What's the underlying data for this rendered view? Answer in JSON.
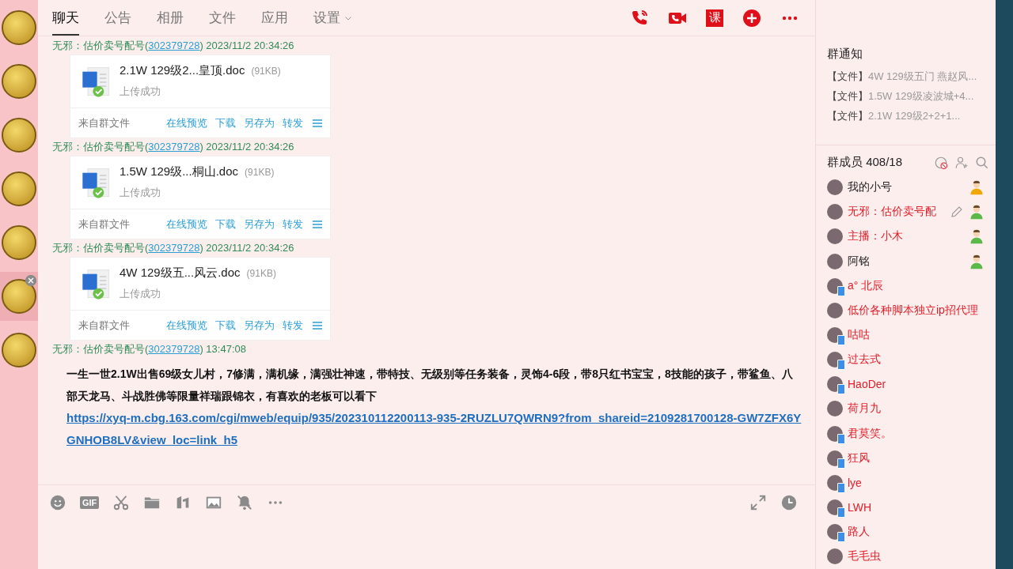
{
  "group_avatars": [
    {
      "selected": false
    },
    {
      "selected": false
    },
    {
      "selected": false
    },
    {
      "selected": false
    },
    {
      "selected": false
    },
    {
      "selected": true
    },
    {
      "selected": false
    }
  ],
  "tabs": [
    {
      "label": "聊天",
      "selected": true,
      "dropdown": false
    },
    {
      "label": "公告",
      "selected": false,
      "dropdown": false
    },
    {
      "label": "相册",
      "selected": false,
      "dropdown": false
    },
    {
      "label": "文件",
      "selected": false,
      "dropdown": false
    },
    {
      "label": "应用",
      "selected": false,
      "dropdown": false
    },
    {
      "label": "设置",
      "selected": false,
      "dropdown": true
    }
  ],
  "header_actions": [
    {
      "kind": "voice-call"
    },
    {
      "kind": "video-call"
    },
    {
      "kind": "course",
      "label": "课"
    },
    {
      "kind": "add"
    },
    {
      "kind": "more"
    }
  ],
  "messages": [
    {
      "kind": "file",
      "sender": "无邪：估价卖号配号(",
      "qq": "302379728",
      "time": ") 2023/11/2 20:34:26",
      "file": {
        "name": "2.1W  129级2...皇顶.doc",
        "size": "(91KB)",
        "status": "上传成功",
        "source": "来自群文件",
        "actions": [
          "在线预览",
          "下载",
          "另存为",
          "转发"
        ]
      }
    },
    {
      "kind": "file",
      "sender": "无邪：估价卖号配号(",
      "qq": "302379728",
      "time": ") 2023/11/2 20:34:26",
      "file": {
        "name": "1.5W  129级...桐山.doc",
        "size": "(91KB)",
        "status": "上传成功",
        "source": "来自群文件",
        "actions": [
          "在线预览",
          "下载",
          "另存为",
          "转发"
        ]
      }
    },
    {
      "kind": "file",
      "sender": "无邪：估价卖号配号(",
      "qq": "302379728",
      "time": ") 2023/11/2 20:34:26",
      "file": {
        "name": "4W  129级五...风云.doc",
        "size": "(91KB)",
        "status": "上传成功",
        "source": "来自群文件",
        "actions": [
          "在线预览",
          "下载",
          "另存为",
          "转发"
        ]
      }
    },
    {
      "kind": "text",
      "sender": "无邪：估价卖号配号(",
      "qq": "302379728",
      "time": ")  13:47:08",
      "text": "一生一世2.1W出售69级女儿村，7修满，满机缘，满强壮神速，带特技、无级别等任务装备，灵饰4-6段，带8只红书宝宝，8技能的孩子，带鲨鱼、八部天龙马、斗战胜佛等限量祥瑞跟锦衣，有喜欢的老板可以看下",
      "link": "https://xyq-m.cbg.163.com/cgi/mweb/equip/935/202310112200113-935-2RUZLU7QWRN9?from_shareid=2109281700128-GW7ZFX6YGNHOB8LV&view_loc=link_h5"
    }
  ],
  "toolbar": [
    {
      "kind": "emoji"
    },
    {
      "kind": "gif",
      "label": "GIF"
    },
    {
      "kind": "scissors"
    },
    {
      "kind": "folder"
    },
    {
      "kind": "music"
    },
    {
      "kind": "image"
    },
    {
      "kind": "bell-off"
    },
    {
      "kind": "more"
    }
  ],
  "toolbar_right": [
    {
      "kind": "expand"
    },
    {
      "kind": "clock"
    }
  ],
  "notices": {
    "title": "群通知",
    "items": [
      {
        "tag": "【文件】",
        "text": "4W  129级五门 燕赵风..."
      },
      {
        "tag": "【文件】",
        "text": "1.5W  129级凌波城+4..."
      },
      {
        "tag": "【文件】",
        "text": "2.1W  129级2+2+1..."
      }
    ]
  },
  "members": {
    "title": "群成员 408/18",
    "items": [
      {
        "name": "我的小号",
        "color": "#222222",
        "owner": true,
        "admin": false,
        "mobile": false,
        "editable": false
      },
      {
        "name": "无邪：估价卖号配",
        "color": "#e0202a",
        "owner": false,
        "admin": true,
        "mobile": false,
        "editable": true
      },
      {
        "name": "主播：小木",
        "color": "#e0202a",
        "owner": false,
        "admin": true,
        "mobile": false,
        "editable": false
      },
      {
        "name": "阿铭",
        "color": "#222222",
        "owner": false,
        "admin": true,
        "mobile": false,
        "editable": false
      },
      {
        "name": "a°  北辰",
        "color": "#e0202a",
        "owner": false,
        "admin": false,
        "mobile": true,
        "editable": false
      },
      {
        "name": "低价各种脚本独立ip招代理",
        "color": "#e0202a",
        "owner": false,
        "admin": false,
        "mobile": false,
        "editable": false
      },
      {
        "name": "咕咕",
        "color": "#e0202a",
        "owner": false,
        "admin": false,
        "mobile": true,
        "editable": false
      },
      {
        "name": "过去式",
        "color": "#e0202a",
        "owner": false,
        "admin": false,
        "mobile": true,
        "editable": false
      },
      {
        "name": "HaoDer",
        "color": "#e0202a",
        "owner": false,
        "admin": false,
        "mobile": true,
        "editable": false
      },
      {
        "name": "荷月九",
        "color": "#e0202a",
        "owner": false,
        "admin": false,
        "mobile": false,
        "editable": false
      },
      {
        "name": "君莫笑。",
        "color": "#e0202a",
        "owner": false,
        "admin": false,
        "mobile": true,
        "editable": false
      },
      {
        "name": "狂风",
        "color": "#e0202a",
        "owner": false,
        "admin": false,
        "mobile": true,
        "editable": false
      },
      {
        "name": "lye",
        "color": "#e0202a",
        "owner": false,
        "admin": false,
        "mobile": true,
        "editable": false
      },
      {
        "name": "LWH",
        "color": "#e0202a",
        "owner": false,
        "admin": false,
        "mobile": true,
        "editable": false
      },
      {
        "name": "路人",
        "color": "#e0202a",
        "owner": false,
        "admin": false,
        "mobile": true,
        "editable": false
      },
      {
        "name": "毛毛虫",
        "color": "#e0202a",
        "owner": false,
        "admin": false,
        "mobile": false,
        "editable": false
      }
    ]
  }
}
